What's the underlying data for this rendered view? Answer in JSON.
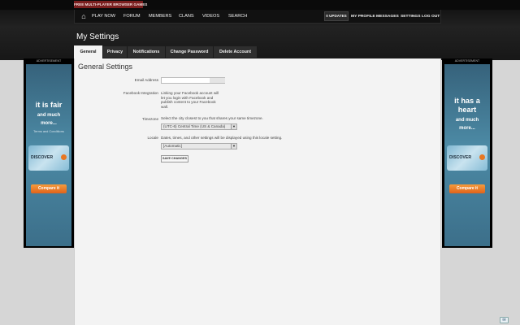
{
  "header": {
    "banner": "FREE MULTI-PLAYER BROWSER GAMES",
    "nav_items": [
      "PLAY NOW",
      "FORUM",
      "MEMBERS",
      "CLANS",
      "VIDEOS",
      "SEARCH"
    ],
    "updates_label": "0 UPDATES",
    "right_links": [
      "MY PROFILE",
      "MESSAGES",
      "SETTINGS",
      "LOG OUT"
    ],
    "home_icon": "home-icon"
  },
  "page": {
    "title": "My Settings",
    "tabs": [
      "General",
      "Privacy",
      "Notifications",
      "Change Password",
      "Delete Account"
    ],
    "active_tab": "General"
  },
  "form": {
    "section_title": "General Settings",
    "email_label": "Email Address",
    "email_value": "",
    "facebook_label": "Facebook Integration",
    "facebook_help": [
      "Linking your Facebook account will",
      "let you login with Facebook and",
      "publish content to your Facebook",
      "wall."
    ],
    "timezone_label": "Timezone",
    "timezone_help": "Select the city closest to you that shares your same timezone.",
    "timezone_value": "(UTC-6) Central Time (US & Canada)",
    "locale_label": "Locale",
    "locale_help": "Dates, times, and other settings will be displayed using this locale setting.",
    "locale_value": "[Automatic]",
    "save_label": "SAVE CHANGES"
  },
  "ads": {
    "label": "ADVERTISEMENT",
    "left": {
      "headline": [
        "it is fair"
      ],
      "sub": [
        "and much",
        "more..."
      ],
      "terms": "Terms and Conditions"
    },
    "right": {
      "headline": [
        "it has a",
        "heart"
      ],
      "sub": [
        "and much",
        "more..."
      ]
    },
    "card_brand": "DISCOVER",
    "cta": "Compare it"
  }
}
